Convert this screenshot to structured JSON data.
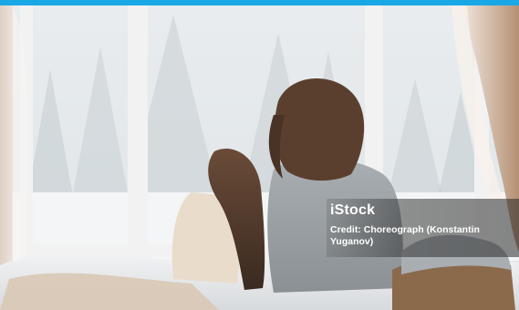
{
  "photo": {
    "description_icon": "photo-image",
    "accent_color": "#1aa7e6"
  },
  "watermark": {
    "logo_text": "iStock",
    "credit_line": "Credit: Choreograph (Konstantin Yuganov)"
  }
}
